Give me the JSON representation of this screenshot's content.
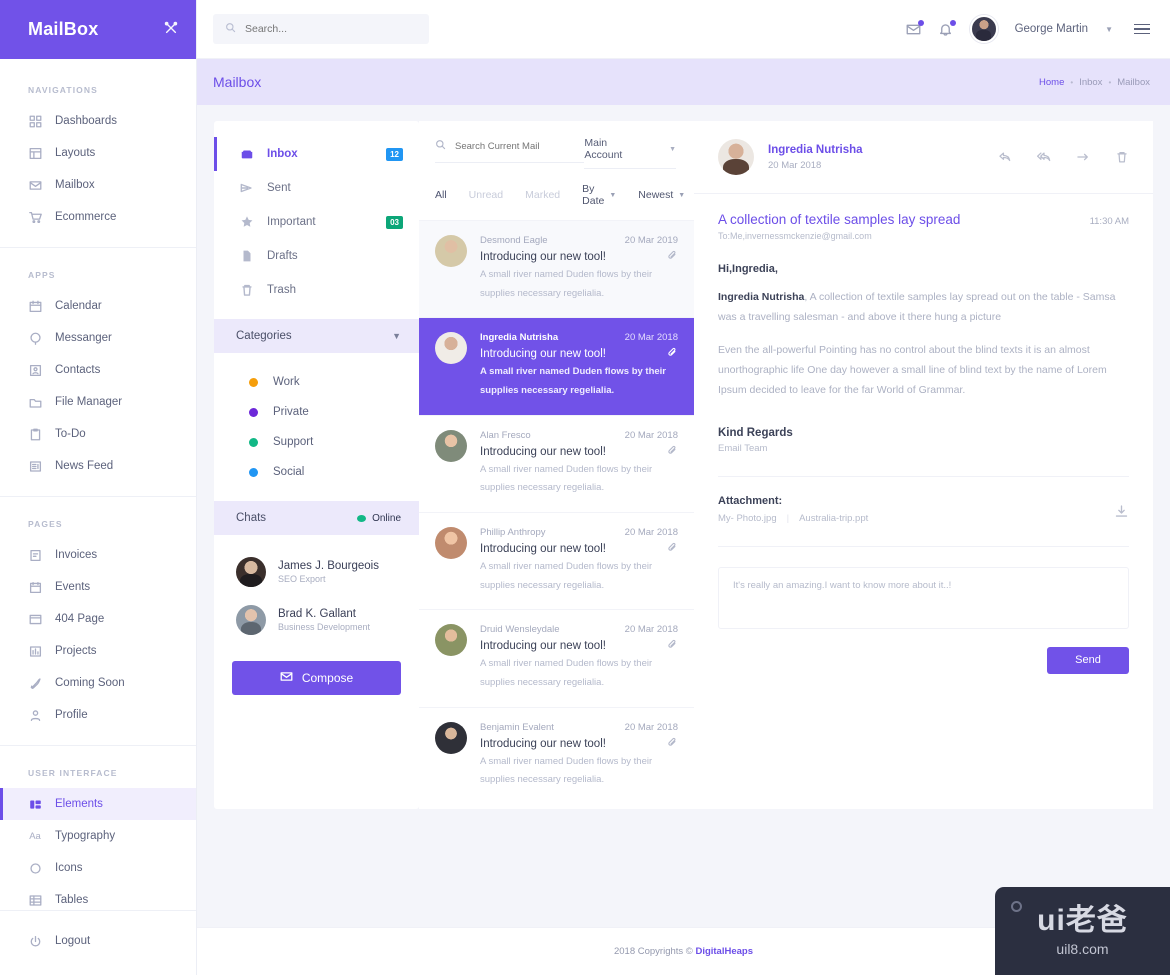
{
  "brand": {
    "name": "MailBox",
    "tool_icon": "tools-icon"
  },
  "sidebar": {
    "sections": [
      {
        "label": "NAVIGATIONS",
        "items": [
          {
            "label": "Dashboards",
            "icon": "grid-icon"
          },
          {
            "label": "Layouts",
            "icon": "layout-icon"
          },
          {
            "label": "Mailbox",
            "icon": "envelope-icon"
          },
          {
            "label": "Ecommerce",
            "icon": "cart-icon"
          }
        ]
      },
      {
        "label": "APPS",
        "items": [
          {
            "label": "Calendar",
            "icon": "calendar-icon"
          },
          {
            "label": "Messanger",
            "icon": "chat-bubble-icon"
          },
          {
            "label": "Contacts",
            "icon": "contact-card-icon"
          },
          {
            "label": "File Manager",
            "icon": "folder-icon"
          },
          {
            "label": "To-Do",
            "icon": "clipboard-icon"
          },
          {
            "label": "News Feed",
            "icon": "news-icon"
          }
        ]
      },
      {
        "label": "PAGES",
        "items": [
          {
            "label": "Invoices",
            "icon": "invoice-icon"
          },
          {
            "label": "Events",
            "icon": "events-icon"
          },
          {
            "label": "404 Page",
            "icon": "browser-icon"
          },
          {
            "label": "Projects",
            "icon": "projects-icon"
          },
          {
            "label": "Coming Soon",
            "icon": "rocket-icon"
          },
          {
            "label": "Profile",
            "icon": "user-icon"
          }
        ]
      },
      {
        "label": "USER INTERFACE",
        "items": [
          {
            "label": "Elements",
            "icon": "elements-icon",
            "active": true
          },
          {
            "label": "Typography",
            "icon": "typography-icon"
          },
          {
            "label": "Icons",
            "icon": "circle-icon"
          },
          {
            "label": "Tables",
            "icon": "table-icon"
          }
        ]
      }
    ],
    "logout": {
      "label": "Logout",
      "icon": "power-icon"
    }
  },
  "topbar": {
    "search_placeholder": "Search...",
    "search_value": "",
    "mail_icon": "mail-notification-icon",
    "bell_icon": "bell-notification-icon",
    "user_name": "George Martin",
    "menu_icon": "hamburger-icon"
  },
  "pagehead": {
    "title": "Mailbox",
    "breadcrumb": [
      "Home",
      "Inbox",
      "Mailbox"
    ]
  },
  "folders": {
    "items": [
      {
        "label": "Inbox",
        "icon": "inbox-icon",
        "badge": "12",
        "badge_color": "blue",
        "active": true
      },
      {
        "label": "Sent",
        "icon": "send-icon",
        "badge": "",
        "badge_color": ""
      },
      {
        "label": "Important",
        "icon": "star-icon",
        "badge": "03",
        "badge_color": "green"
      },
      {
        "label": "Drafts",
        "icon": "draft-icon",
        "badge": "",
        "badge_color": ""
      },
      {
        "label": "Trash",
        "icon": "trash-icon",
        "badge": "",
        "badge_color": ""
      }
    ],
    "categories_title": "Categories",
    "categories": [
      {
        "label": "Work",
        "color": "#f59e0b"
      },
      {
        "label": "Private",
        "color": "#6d28d9"
      },
      {
        "label": "Support",
        "color": "#12b886"
      },
      {
        "label": "Social",
        "color": "#2196f3"
      }
    ],
    "chats_title": "Chats",
    "chats_status": "Online",
    "chats": [
      {
        "name": "James J. Bourgeois",
        "role": "SEO Export"
      },
      {
        "name": "Brad K. Gallant",
        "role": "Business Development"
      }
    ],
    "compose_label": "Compose"
  },
  "maillist": {
    "search_placeholder": "Search Current Mail",
    "account": "Main Account",
    "tabs": [
      "All",
      "Unread",
      "Marked"
    ],
    "sort_by": "By Date",
    "sort_order": "Newest",
    "messages": [
      {
        "from": "Desmond Eagle",
        "date": "20 Mar 2019",
        "subject": "Introducing our new tool!",
        "preview": "A small river named Duden flows by their supplies necessary regelialia.",
        "selected": false
      },
      {
        "from": "Ingredia Nutrisha",
        "date": "20 Mar 2018",
        "subject": "Introducing our new tool!",
        "preview": "A small river named Duden flows by their supplies necessary regelialia.",
        "selected": true
      },
      {
        "from": "Alan Fresco",
        "date": "20 Mar 2018",
        "subject": "Introducing our new tool!",
        "preview": "A small river named Duden flows by their supplies necessary regelialia.",
        "selected": false
      },
      {
        "from": "Phillip Anthropy",
        "date": "20 Mar 2018",
        "subject": "Introducing our new tool!",
        "preview": "A small river named Duden flows by their supplies necessary regelialia.",
        "selected": false
      },
      {
        "from": "Druid Wensleydale",
        "date": "20 Mar 2018",
        "subject": "Introducing our new tool!",
        "preview": "A small river named Duden flows by their supplies necessary regelialia.",
        "selected": false
      },
      {
        "from": "Benjamin Evalent",
        "date": "20 Mar 2018",
        "subject": "Introducing our new tool!",
        "preview": "A small river named Duden flows by their supplies necessary regelialia.",
        "selected": false
      }
    ]
  },
  "reader": {
    "sender": "Ingredia Nutrisha",
    "sent_date": "20 Mar 2018",
    "actions": [
      "reply-icon",
      "reply-all-icon",
      "forward-icon",
      "delete-icon"
    ],
    "subject": "A collection of textile samples lay spread",
    "time": "11:30 AM",
    "to": "To:Me,invernessmckenzie@gmail.com",
    "greeting": "Hi,Ingredia,",
    "para1_lead": "Ingredia Nutrisha",
    "para1_rest": ", A collection of textile samples lay spread out on the table - Samsa was a travelling salesman - and above it there hung a picture",
    "para2": "Even the all-powerful Pointing has no control about the blind texts it is an almost unorthographic life One day however a small line of blind text by the name of Lorem Ipsum decided to leave for the far World of Grammar.",
    "regards": "Kind Regards",
    "team": "Email Team",
    "attachment_title": "Attachment:",
    "attachments": [
      "My- Photo.jpg",
      "Australia-trip.ppt"
    ],
    "download_icon": "download-icon",
    "reply_placeholder": "It's really an amazing.I want to know more about it..!",
    "send_label": "Send"
  },
  "footer": {
    "text": "2018 Copyrights ©",
    "brand": "DigitalHeaps"
  },
  "watermark": {
    "logo": "ui老爸",
    "sub": "uil8.com"
  },
  "colors": {
    "primary": "#7152e8",
    "accent": "#6c4ee8",
    "pagehead_bg": "#e6e2fb",
    "badge_blue": "#2196f3",
    "badge_green": "#0ca678"
  }
}
